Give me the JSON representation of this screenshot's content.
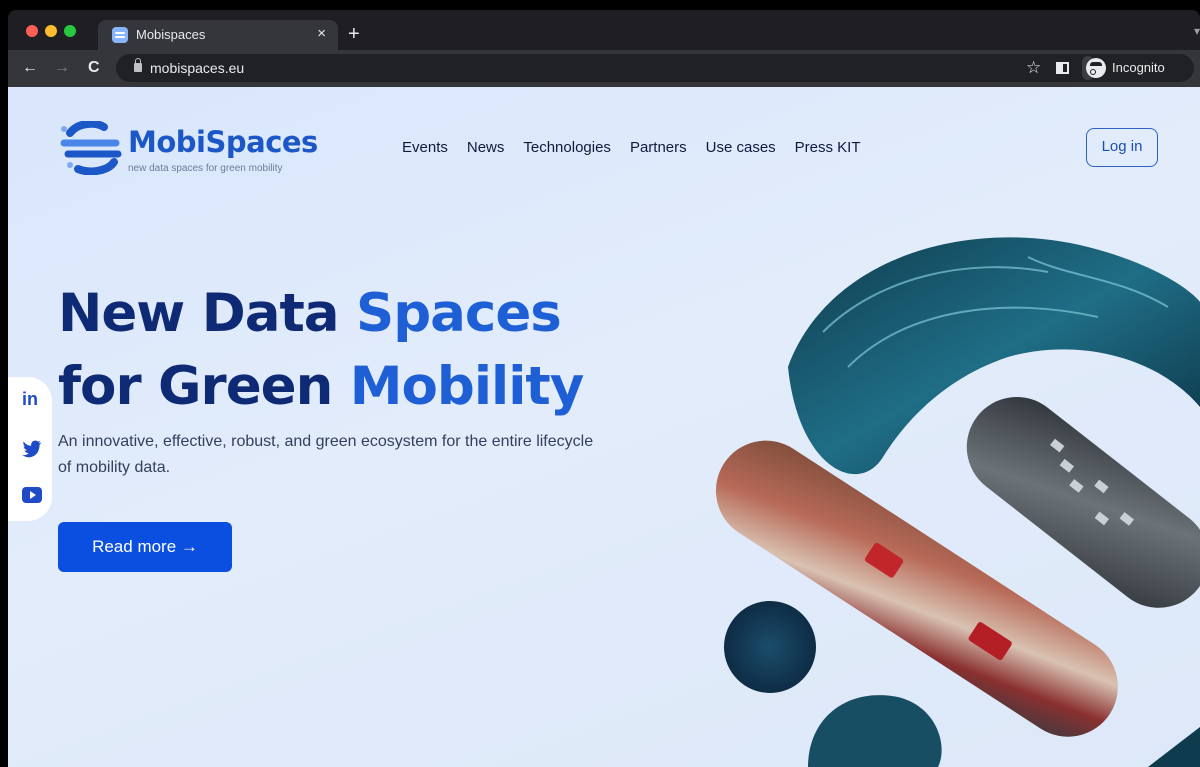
{
  "browser": {
    "tab_title": "Mobispaces",
    "tab_close": "×",
    "new_tab": "+",
    "url": "mobispaces.eu",
    "profile_label": "Incognito",
    "star": "☆"
  },
  "site": {
    "logo_text": "MobiSpaces",
    "logo_tagline": "new data spaces for green mobility",
    "nav": [
      "Events",
      "News",
      "Technologies",
      "Partners",
      "Use cases",
      "Press KIT"
    ],
    "login_label": "Log in"
  },
  "hero": {
    "title_line1_dark": "New Data ",
    "title_line1_blue": "Spaces",
    "title_line2_dark": "for Green ",
    "title_line2_blue": "Mobility",
    "subtitle": "An innovative, effective, robust, and green ecosystem for the entire lifecycle of mobility data.",
    "cta_label": "Read more →"
  },
  "social": {
    "linkedin_glyph": "in"
  },
  "colors": {
    "brand_blue": "#1c57c8",
    "title_dark": "#0f2a74",
    "cta_blue": "#0b4fe0"
  }
}
